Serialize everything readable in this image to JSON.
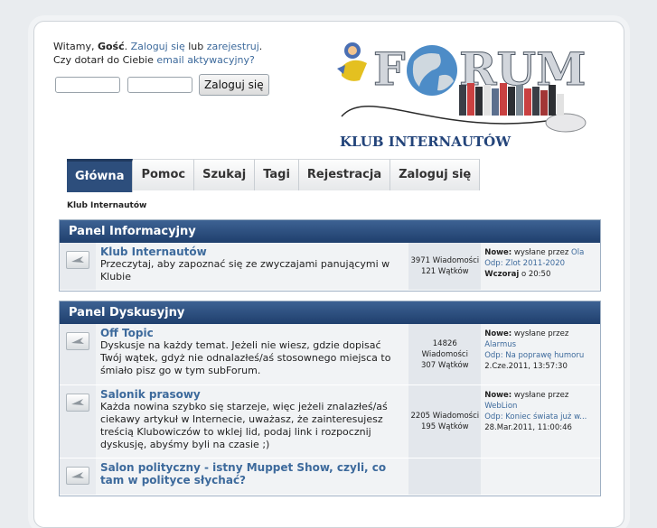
{
  "header": {
    "greeting_prefix": "Witamy,",
    "guest": "Gość",
    "greeting_dot": ".",
    "login_link": "Zaloguj się",
    "or": "lub",
    "register_link": "zarejestruj",
    "register_dot": ".",
    "activation_question": "Czy dotarł do Ciebie",
    "activation_link": "email aktywacyjny?",
    "login_button": "Zaloguj się"
  },
  "logo": {
    "title": "FORUM",
    "subtitle": "KLUB INTERNAUTÓW"
  },
  "tabs": [
    {
      "label": "Główna",
      "active": true
    },
    {
      "label": "Pomoc"
    },
    {
      "label": "Szukaj"
    },
    {
      "label": "Tagi"
    },
    {
      "label": "Rejestracja"
    },
    {
      "label": "Zaloguj się"
    }
  ],
  "breadcrumb": "Klub Internautów",
  "panels": [
    {
      "title": "Panel Informacyjny",
      "forums": [
        {
          "name": "Klub Internautów",
          "description": "Przeczytaj, aby zapoznać się ze zwyczajami panującymi w Klubie",
          "posts": "3971 Wiadomości",
          "threads": "121 Wątków",
          "last_new": "Nowe:",
          "last_by": "wysłane przez",
          "last_author": "Ola",
          "last_topic": "Odp: Zlot 2011-2020",
          "last_date_bold": "Wczoraj",
          "last_time": "o 20:50"
        }
      ]
    },
    {
      "title": "Panel Dyskusyjny",
      "forums": [
        {
          "name": "Off Topic",
          "description": "Dyskusje na każdy temat. Jeżeli nie wiesz, gdzie dopisać Twój wątek, gdyż nie odnalazłeś/aś stosownego miejsca to śmiało pisz go w tym subForum.",
          "posts_number": "14826",
          "posts_word": "Wiadomości",
          "threads": "307 Wątków",
          "last_new": "Nowe:",
          "last_by": "wysłane przez",
          "last_author": "Alarmus",
          "last_topic": "Odp: Na poprawę humoru",
          "last_date": "2.Cze.2011, 13:57:30"
        },
        {
          "name": "Salonik prasowy",
          "description": "Każda nowina szybko się starzeje, więc jeżeli znalazłeś/aś ciekawy artykuł w Internecie, uważasz, że zainteresujesz treścią Klubowiczów to wklej lid, podaj link i rozpocznij dyskusję, abyśmy byli na czasie ;)",
          "posts": "2205 Wiadomości",
          "threads": "195 Wątków",
          "last_new": "Nowe:",
          "last_by": "wysłane przez",
          "last_author": "WebLion",
          "last_topic": "Odp: Koniec świata już w...",
          "last_date": "28.Mar.2011, 11:00:46"
        },
        {
          "name": "Salon polityczny - istny Muppet Show, czyli, co tam w polityce słychać?"
        }
      ]
    }
  ],
  "colors": {
    "panel_header": "#2d4e7c",
    "link": "#3d6a9c",
    "active_tab": "#2d4e7c"
  },
  "icons": [
    "forum-board-icon",
    "logo-mascot",
    "globe-icon",
    "computer-mouse-icon"
  ]
}
